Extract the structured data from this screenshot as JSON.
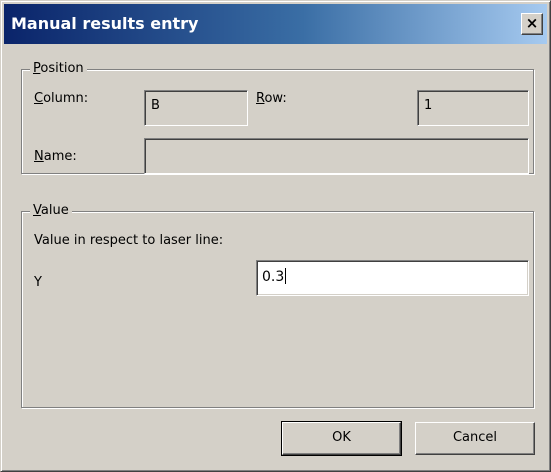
{
  "window": {
    "title": "Manual results entry",
    "close_glyph": "×"
  },
  "position_group": {
    "label_mnemonic": "P",
    "label_rest": "osition",
    "column_label_mnemonic": "C",
    "column_label_rest": "olumn:",
    "column_value": "B",
    "row_label_mnemonic": "R",
    "row_label_rest": "ow:",
    "row_value": "1",
    "name_label_mnemonic": "N",
    "name_label_rest": "ame:",
    "name_value": ""
  },
  "value_group": {
    "label_mnemonic": "V",
    "label_rest": "alue",
    "description": "Value in respect to laser line:",
    "y_label": "Y",
    "y_value": "0.3"
  },
  "buttons": {
    "ok_label": "OK",
    "cancel_label": "Cancel"
  },
  "colors": {
    "face": "#d4d0c8",
    "title_start": "#0a246a",
    "title_end": "#a6caf0"
  },
  "icons": {
    "close": "close-icon"
  }
}
